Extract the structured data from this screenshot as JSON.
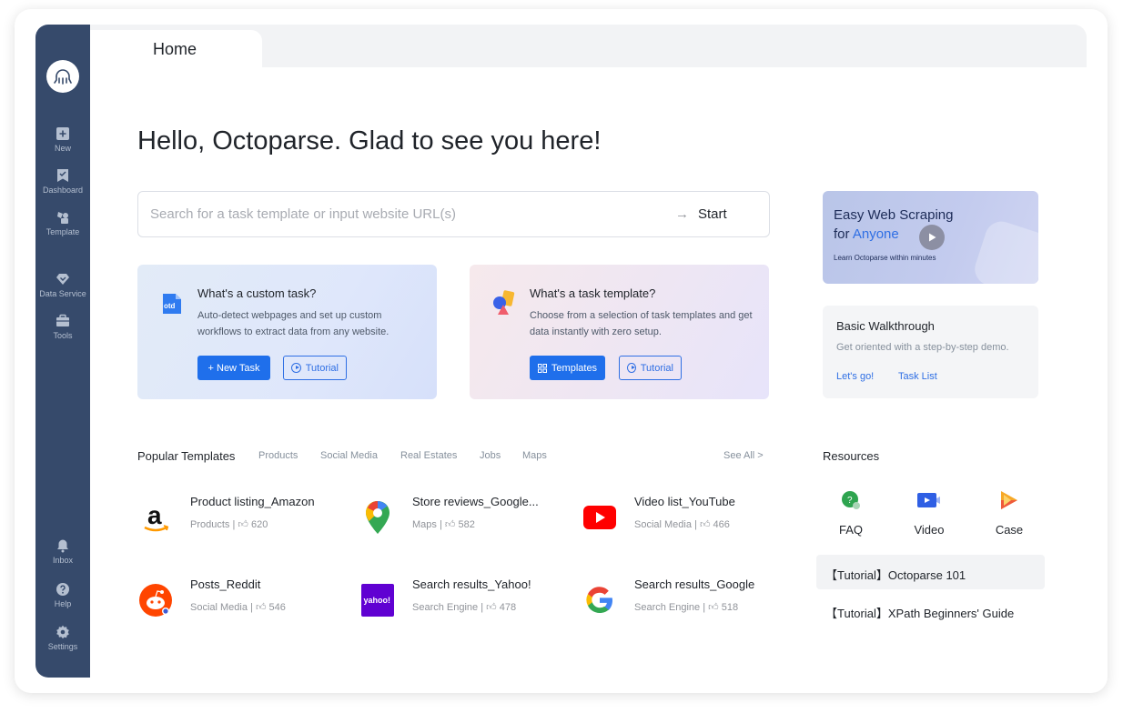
{
  "app": {
    "name": "Octoparse"
  },
  "colors": {
    "sidebar": "#364a6b",
    "accent": "#1f6feb",
    "link": "#2f6fe4"
  },
  "sidebar": {
    "logo_icon": "octopus-logo-icon",
    "top_items": [
      {
        "label": "New",
        "icon": "plus-square-icon"
      },
      {
        "label": "Dashboard",
        "icon": "bookmark-check-icon"
      },
      {
        "label": "Template",
        "icon": "template-icon"
      },
      {
        "label": "Data Service",
        "icon": "diamond-icon"
      },
      {
        "label": "Tools",
        "icon": "toolbox-icon"
      }
    ],
    "bottom_items": [
      {
        "label": "Inbox",
        "icon": "bell-icon"
      },
      {
        "label": "Help",
        "icon": "help-icon"
      },
      {
        "label": "Settings",
        "icon": "gear-icon"
      }
    ]
  },
  "tabs": [
    {
      "label": "Home",
      "active": true
    }
  ],
  "main": {
    "greeting": "Hello, Octoparse. Glad to see you here!",
    "search": {
      "placeholder": "Search for a task template or input website URL(s)",
      "value": "",
      "start_label": "Start"
    }
  },
  "cards": {
    "custom": {
      "icon": "otd-doc-icon",
      "title": "What's a custom task?",
      "description": "Auto-detect webpages and set up custom workflows to extract data from any website.",
      "primary_button": "+ New Task",
      "secondary_button": "Tutorial"
    },
    "template": {
      "icon": "shapes-icon",
      "title": "What's a task template?",
      "description": "Choose from a selection of task templates and get data instantly with zero setup.",
      "primary_button": "Templates",
      "secondary_button": "Tutorial"
    }
  },
  "promo": {
    "line1": "Easy Web Scraping",
    "line2_prefix": "for ",
    "line2_highlight": "Anyone",
    "subtitle": "Learn Octoparse within minutes"
  },
  "walkthrough": {
    "title": "Basic Walkthrough",
    "description": "Get oriented with a step-by-step demo.",
    "links": [
      "Let's go!",
      "Task List"
    ]
  },
  "popular": {
    "title": "Popular Templates",
    "filters": [
      "Products",
      "Social Media",
      "Real Estates",
      "Jobs",
      "Maps"
    ],
    "see_all": "See All >",
    "items": [
      {
        "name": "Product listing_Amazon",
        "category": "Products",
        "likes": "620",
        "icon": "amazon-logo-icon"
      },
      {
        "name": "Store reviews_Google...",
        "category": "Maps",
        "likes": "582",
        "icon": "google-maps-pin-icon"
      },
      {
        "name": "Video list_YouTube",
        "category": "Social Media",
        "likes": "466",
        "icon": "youtube-logo-icon"
      },
      {
        "name": "Posts_Reddit",
        "category": "Social Media",
        "likes": "546",
        "icon": "reddit-logo-icon"
      },
      {
        "name": "Search results_Yahoo!",
        "category": "Search Engine",
        "likes": "478",
        "icon": "yahoo-logo-icon"
      },
      {
        "name": "Search results_Google",
        "category": "Search Engine",
        "likes": "518",
        "icon": "google-logo-icon"
      }
    ]
  },
  "resources": {
    "title": "Resources",
    "items": [
      {
        "label": "FAQ",
        "icon": "faq-icon"
      },
      {
        "label": "Video",
        "icon": "video-icon"
      },
      {
        "label": "Case",
        "icon": "case-icon"
      }
    ],
    "guides": [
      "【Tutorial】Octoparse 101",
      "【Tutorial】XPath Beginners' Guide"
    ]
  }
}
